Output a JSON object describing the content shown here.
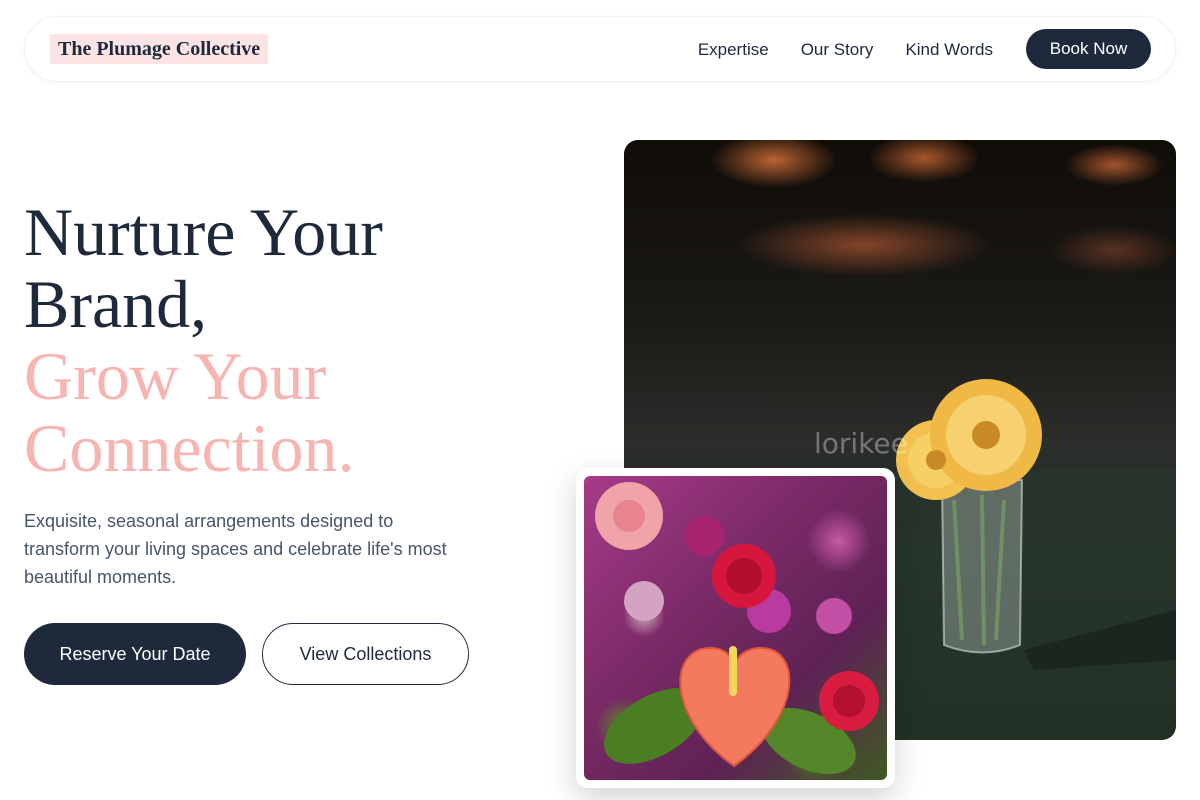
{
  "header": {
    "brand": "The Plumage Collective",
    "nav": [
      "Expertise",
      "Our Story",
      "Kind Words"
    ],
    "cta": "Book Now"
  },
  "hero": {
    "title_line1": "Nurture Your",
    "title_line2": "Brand,",
    "title_line3": "Grow Your",
    "title_line4": "Connection.",
    "subtitle": "Exquisite, seasonal arrangements designed to transform your living spaces and celebrate life's most beautiful moments.",
    "primary_button": "Reserve Your Date",
    "secondary_button": "View Collections"
  },
  "images": {
    "watermark": "lorikee"
  },
  "colors": {
    "navy": "#1e293b",
    "pink_accent": "#f8b4b0",
    "logo_highlight": "#fde4e4"
  }
}
